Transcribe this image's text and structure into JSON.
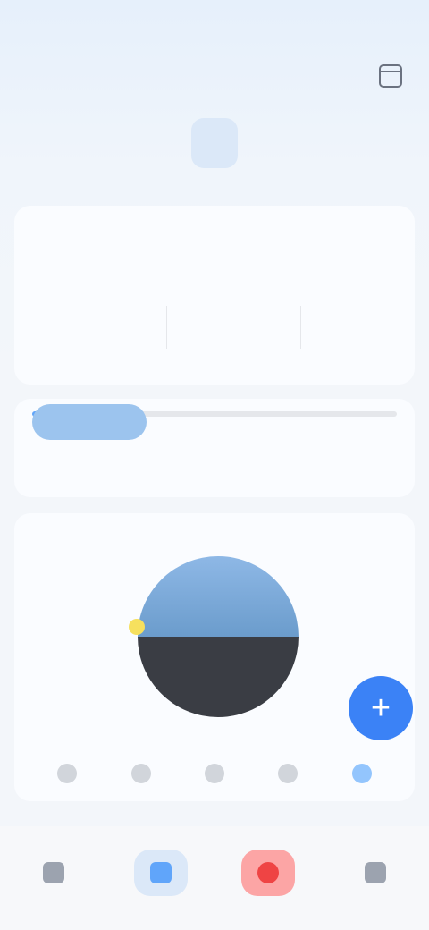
{
  "header": {
    "date_big": "",
    "date_sub": "",
    "status_right": ""
  },
  "week": [
    {
      "dw": "",
      "dn": "",
      "active": false
    },
    {
      "dw": "",
      "dn": "",
      "active": false
    },
    {
      "dw": "",
      "dn": "",
      "active": false
    },
    {
      "dw": "",
      "dn": "",
      "active": true
    },
    {
      "dw": "",
      "dn": "",
      "active": false
    },
    {
      "dw": "",
      "dn": "",
      "active": false
    },
    {
      "dw": "",
      "dn": "",
      "active": false
    }
  ],
  "sections": {
    "summary_label": "",
    "sleep_label": ""
  },
  "summary": {
    "title": "",
    "metrics": [
      "",
      "",
      ""
    ]
  },
  "progress": {
    "fraction": 0.3,
    "stat_left": "",
    "stat_right": ""
  },
  "sleep_chart": {
    "title": "",
    "left_text": "",
    "right_text": "",
    "bottom_text": ""
  },
  "icons": {
    "calendar": "calendar-icon",
    "fab": "add-icon",
    "tabs": [
      "home-icon",
      "stats-icon",
      "record-icon",
      "profile-icon"
    ]
  },
  "fab": {
    "label": "+"
  },
  "colors": {
    "accent": "#3b82f6",
    "record": "#ef4444",
    "night": "#3a3d44",
    "sun": "#f6e05e"
  }
}
